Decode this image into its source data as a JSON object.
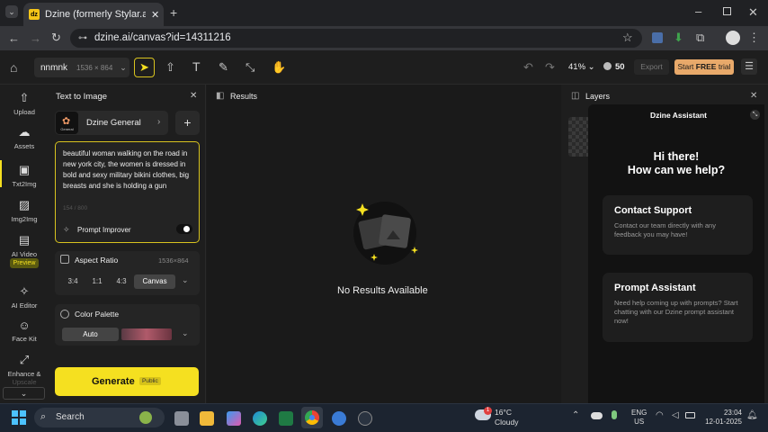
{
  "browser": {
    "tab_title": "Dzine (formerly Stylar.ai) - The F",
    "tab_favicon": "dz",
    "url": "dzine.ai/canvas?id=14311216"
  },
  "toolbar": {
    "project_name": "nnmnk",
    "canvas_size": "1536 × 864",
    "zoom": "41%",
    "credits": "50",
    "export_label": "Export",
    "trial_prefix": "Start ",
    "trial_bold": "FREE",
    "trial_suffix": " trial"
  },
  "nav": {
    "upload": "Upload",
    "assets": "Assets",
    "txt2img": "Txt2Img",
    "img2img": "Img2Img",
    "ai_video": "AI Video",
    "preview": "Preview",
    "ai_editor": "AI Editor",
    "face_kit": "Face Kit",
    "enhance": "Enhance &",
    "upscale": "Upscale"
  },
  "panel": {
    "title": "Text to Image",
    "model": "Dzine General",
    "model_thumb": "General",
    "prompt": " beautiful woman walking on the road in new york city, the women is dressed in bold and sexy military bikini clothes, big breasts and she is holding a gun",
    "char_count": "154 / 800",
    "prompt_improver": "Prompt Improver",
    "aspect_ratio_label": "Aspect Ratio",
    "aspect_ratio_value": "1536×864",
    "ratios": [
      "3:4",
      "1:1",
      "4:3",
      "Canvas"
    ],
    "color_palette_label": "Color Palette",
    "palette_auto": "Auto",
    "generate": "Generate",
    "public_badge": "Public"
  },
  "results": {
    "title": "Results",
    "empty": "No Results Available"
  },
  "layers": {
    "title": "Layers"
  },
  "assistant": {
    "title": "Dzine Assistant",
    "greeting1": "Hi there!",
    "greeting2": "How can we help?",
    "contact_title": "Contact Support",
    "contact_desc": "Contact our team directly with any feedback you may have!",
    "prompt_title": "Prompt Assistant",
    "prompt_desc": "Need help coming up with prompts? Start chatting with our Dzine prompt assistant now!"
  },
  "taskbar": {
    "search": "Search",
    "weather_temp": "16°C",
    "weather_desc": "Cloudy",
    "weather_badge": "1",
    "lang1": "ENG",
    "lang2": "US",
    "time": "23:04",
    "date": "12-01-2025"
  },
  "colors": {
    "accent": "#f5e020",
    "bg": "#1c1c1c",
    "trial": "#e8a96a"
  }
}
